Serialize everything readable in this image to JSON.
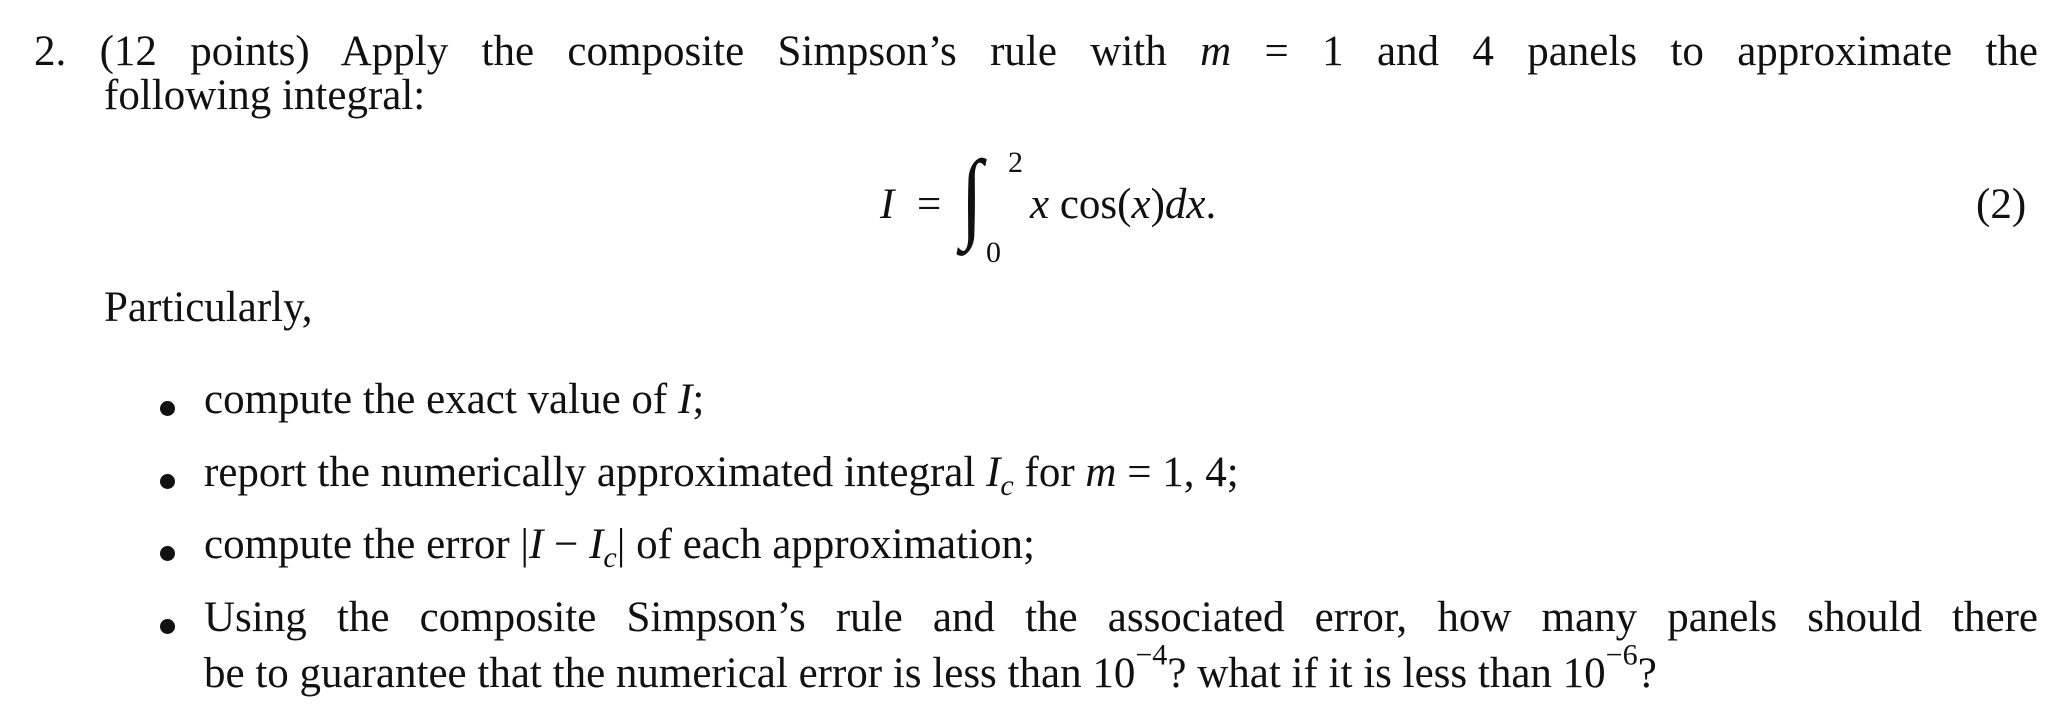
{
  "problem": {
    "number": "2.",
    "points": "(12 points)",
    "intro_part1": "Apply the composite Simpson’s rule with",
    "m_symbol": "m",
    "equals": "=",
    "intro_part2": "1 and 4 panels to approximate the",
    "intro_line2": "following integral:"
  },
  "equation": {
    "lhs": "I",
    "equals": "=",
    "integral_symbol": "∫",
    "lower_limit": "0",
    "upper_limit": "2",
    "integrand_x": "x",
    "integrand_cos": "cos(",
    "integrand_arg": "x",
    "integrand_close": ")",
    "differential": "dx",
    "end": ".",
    "number": "(2)"
  },
  "particularly": "Particularly,",
  "bullets": [
    {
      "pre": "compute the exact value of",
      "math": "I",
      "post": ";"
    },
    {
      "pre": "report the numerically approximated integral",
      "math": "I",
      "sub": "c",
      "mid": "for",
      "m": "m",
      "eq": "= 1, 4;"
    },
    {
      "pre": "compute the error",
      "abs_open": "|",
      "I": "I",
      "minus": " − ",
      "Ic": "I",
      "sub": "c",
      "abs_close": "|",
      "post": "of each approximation;"
    },
    {
      "line1": "Using the composite Simpson’s rule and the associated error, how many panels should there",
      "line2_pre": "be to guarantee that the numerical error is less than 10",
      "exp1": "−4",
      "line2_mid": "? what if it is less than 10",
      "exp2": "−6",
      "line2_end": "?"
    }
  ]
}
